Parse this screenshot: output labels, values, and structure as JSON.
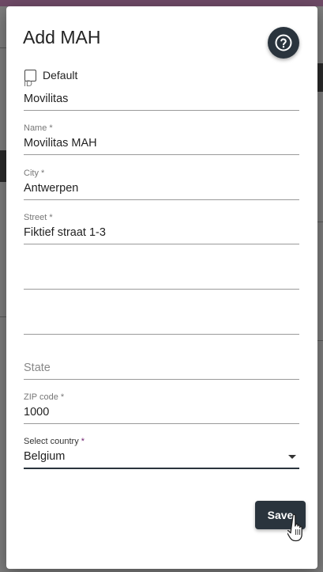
{
  "dialog": {
    "title": "Add MAH",
    "help_icon": "help-circle-icon",
    "default_checkbox": {
      "label": "Default",
      "checked": false
    },
    "fields": {
      "id": {
        "label": "ID",
        "value": "Movilitas"
      },
      "name": {
        "label": "Name *",
        "value": "Movilitas MAH"
      },
      "city": {
        "label": "City *",
        "value": "Antwerpen"
      },
      "street": {
        "label": "Street *",
        "value": "Fiktief straat 1-3"
      },
      "address_line_2": {
        "value": ""
      },
      "address_line_3": {
        "value": ""
      },
      "state": {
        "placeholder": "State"
      },
      "zip": {
        "label": "ZIP code *",
        "value": "1000"
      },
      "country": {
        "label": "Select country",
        "required_mark": "*",
        "value": "Belgium"
      }
    },
    "save_label": "Save"
  },
  "colors": {
    "primary_dark": "#2a343d",
    "required_accent": "#6e1f6e",
    "overlay": "#7d7d7d"
  }
}
